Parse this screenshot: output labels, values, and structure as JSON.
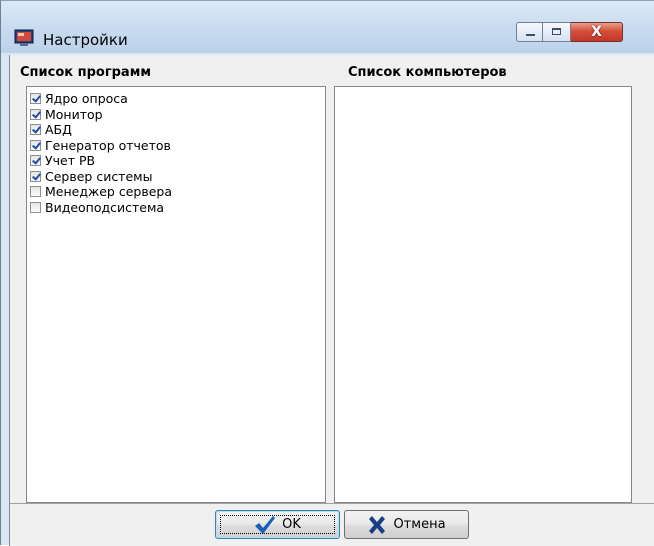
{
  "window": {
    "title": "Настройки",
    "icon": "app-icon",
    "controls": [
      "minimize-icon",
      "maximize-icon",
      "close-icon"
    ],
    "close_glyph": "X"
  },
  "programs_panel": {
    "label": "Список программ",
    "items": [
      {
        "label": "Ядро опроса",
        "checked": true
      },
      {
        "label": "Монитор",
        "checked": true
      },
      {
        "label": "АБД",
        "checked": true
      },
      {
        "label": "Генератор отчетов",
        "checked": true
      },
      {
        "label": "Учет РВ",
        "checked": true
      },
      {
        "label": "Сервер системы",
        "checked": true
      },
      {
        "label": "Менеджер сервера",
        "checked": false
      },
      {
        "label": "Видеоподсистема",
        "checked": false
      }
    ]
  },
  "computers_panel": {
    "label": "Список компьютеров",
    "items": []
  },
  "buttons": {
    "ok_label": "OK",
    "ok_icon": "checkmark-icon",
    "cancel_label": "Отмена",
    "cancel_icon": "cross-icon"
  },
  "colors": {
    "checkmark": "#1f4fa8",
    "ok_icon": "#1560b8",
    "cancel_icon": "#1a3e86",
    "close_button": "#c4362a"
  }
}
